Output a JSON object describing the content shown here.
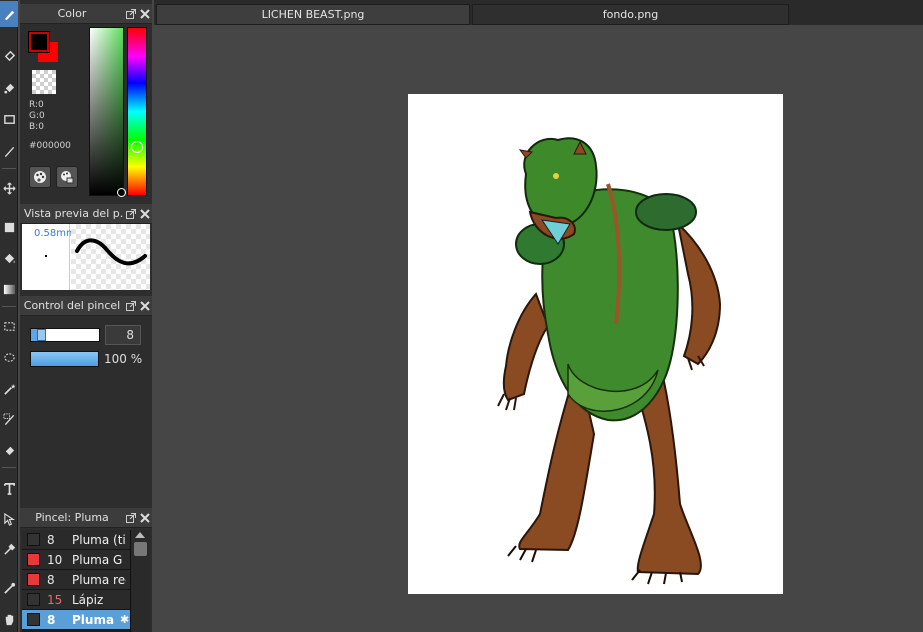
{
  "tools": [
    {
      "name": "brush-tool-icon",
      "active": true
    },
    {
      "name": "eraser-tool-icon"
    },
    {
      "name": "bucket-eraser-icon"
    },
    {
      "name": "rectangle-tool-icon"
    },
    {
      "name": "pen-tool-icon"
    },
    {
      "name": "move-tool-icon"
    },
    {
      "name": "square-shape-icon"
    },
    {
      "name": "fill-bucket-icon"
    },
    {
      "name": "gradient-tool-icon"
    },
    {
      "name": "rect-select-icon"
    },
    {
      "name": "lasso-select-icon"
    },
    {
      "name": "magic-wand-icon"
    },
    {
      "name": "select-pen-icon"
    },
    {
      "name": "select-eraser-icon"
    },
    {
      "name": "text-tool-icon"
    },
    {
      "name": "operation-tool-icon"
    },
    {
      "name": "eyedropper-icon"
    },
    {
      "name": "magic-pen-icon"
    },
    {
      "name": "hand-tool-icon"
    }
  ],
  "color_panel": {
    "title": "Color",
    "r": "R:0",
    "g": "G:0",
    "b": "B:0",
    "hex": "#000000",
    "foreground": "#000000",
    "background": "#ff0000"
  },
  "preview_panel": {
    "title": "Vista previa del p...",
    "size": "0.58mm"
  },
  "brush_control": {
    "title": "Control del pincel",
    "size_value": "8",
    "opacity_value": "100 %",
    "size_fraction": 0.15,
    "opacity_fraction": 1.0
  },
  "brush_list": {
    "title": "Pincel: Pluma",
    "items": [
      {
        "size": "8",
        "name": "Pluma (tinta)",
        "color": "#333333",
        "selected": false,
        "size_color": "#e8e8e8"
      },
      {
        "size": "10",
        "name": "Pluma G",
        "color": "#e63a3a",
        "selected": false,
        "size_color": "#e8e8e8"
      },
      {
        "size": "8",
        "name": "Pluma redonda",
        "color": "#e63a3a",
        "selected": false,
        "size_color": "#e8e8e8"
      },
      {
        "size": "15",
        "name": "Lápiz",
        "color": "#333333",
        "selected": false,
        "size_color": "#e06c6c"
      },
      {
        "size": "8",
        "name": "Pluma",
        "color": "#333333",
        "selected": true,
        "size_color": "#ffffff"
      }
    ]
  },
  "tabs": [
    {
      "label": "LICHEN BEAST.png",
      "active": true
    },
    {
      "label": "fondo.png",
      "active": false
    }
  ]
}
